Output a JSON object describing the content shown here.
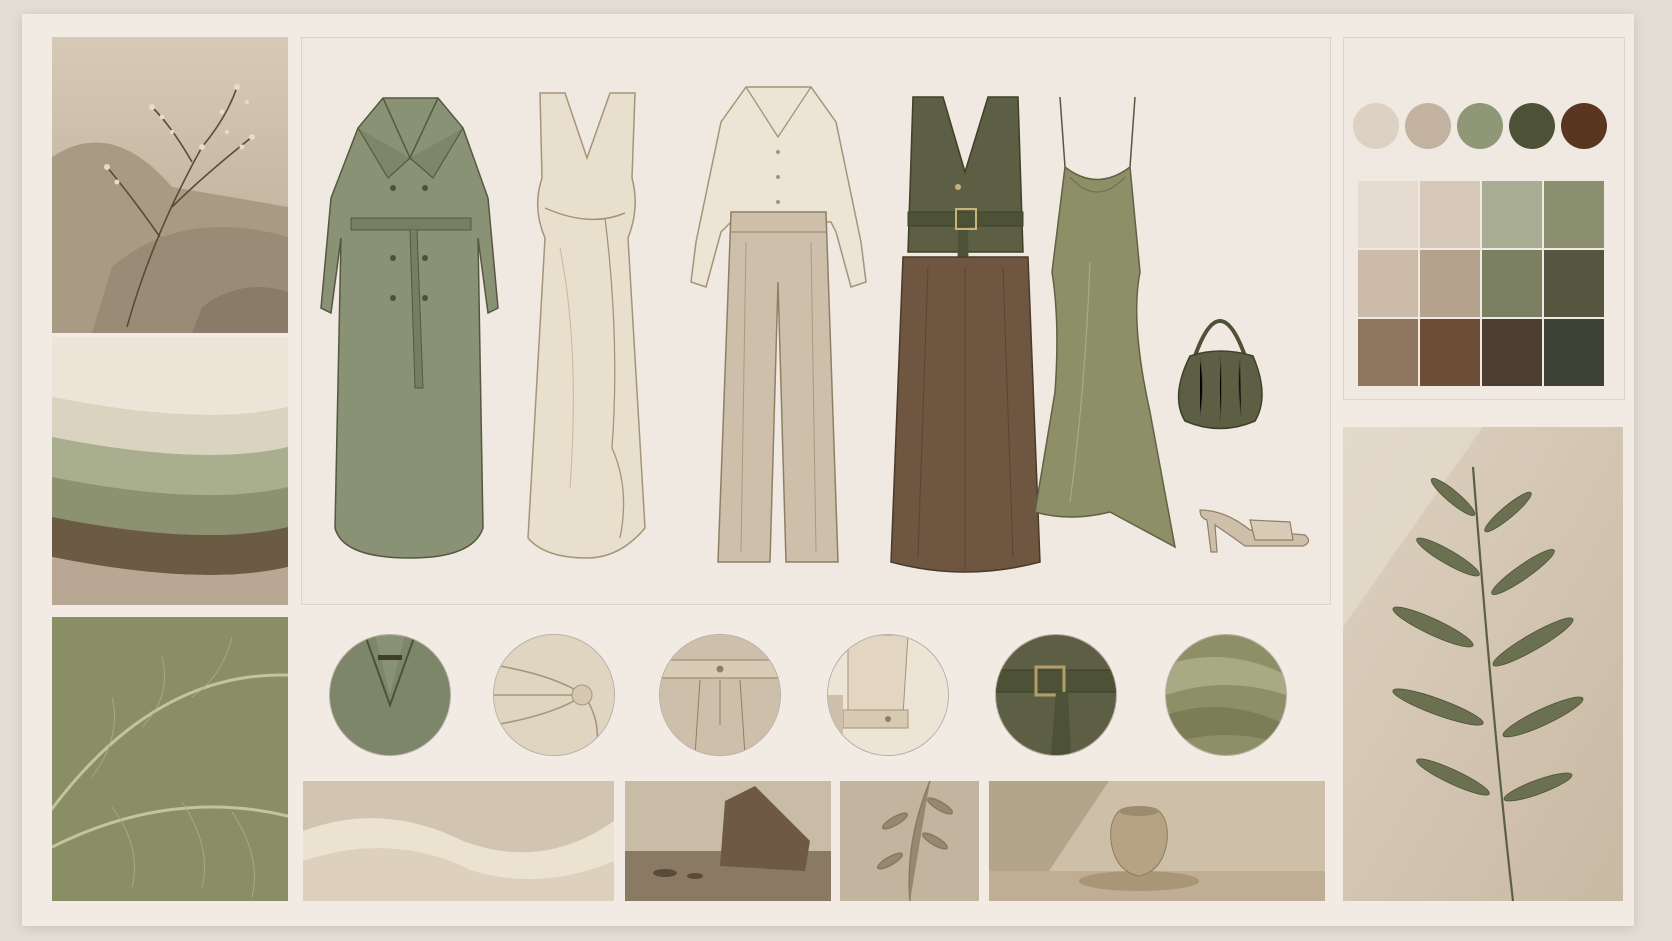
{
  "palette": {
    "dots": [
      "#dcd1c3",
      "#c2b29f",
      "#8e9877",
      "#4d5236",
      "#5a3520"
    ],
    "swatches": [
      [
        "#e5dbd0",
        "#d5c8b8",
        "#a8ad94",
        "#8a8f6f"
      ],
      [
        "#cbbba8",
        "#b5a28d",
        "#7c8063",
        "#545640"
      ],
      [
        "#8e7660",
        "#6e4d36",
        "#4b3e31",
        "#3e4236"
      ]
    ]
  },
  "colors": {
    "olive": "#8a9275",
    "olive_dark": "#5d5f44",
    "cream": "#e8dfcc",
    "beige": "#cdbfaa",
    "brown": "#6e5640",
    "sage_silk": "#8d9066"
  }
}
